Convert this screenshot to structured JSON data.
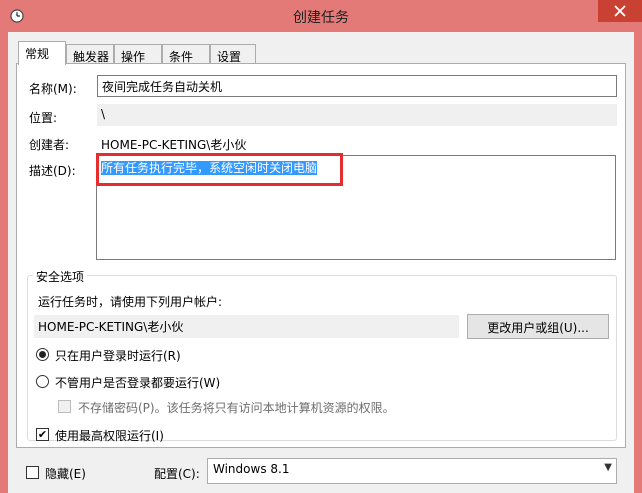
{
  "window": {
    "title": "创建任务"
  },
  "tabs": [
    {
      "label": "常规",
      "active": true
    },
    {
      "label": "触发器",
      "active": false
    },
    {
      "label": "操作",
      "active": false
    },
    {
      "label": "条件",
      "active": false
    },
    {
      "label": "设置",
      "active": false
    }
  ],
  "general": {
    "name_label": "名称(M):",
    "name_value": "夜间完成任务自动关机",
    "location_label": "位置:",
    "location_value": "\\",
    "author_label": "创建者:",
    "author_value": "HOME-PC-KETING\\老小伙",
    "description_label": "描述(D):",
    "description_value": "所有任务执行完毕，系统空闲时关闭电脑"
  },
  "security": {
    "group_title": "安全选项",
    "run_as_prompt": "运行任务时，请使用下列用户帐户:",
    "account_value": "HOME-PC-KETING\\老小伙",
    "change_user_button": "更改用户或组(U)...",
    "radio_logged_on": "只在用户登录时运行(R)",
    "radio_logged_on_checked": true,
    "radio_whether_logged": "不管用户是否登录都要运行(W)",
    "radio_whether_logged_checked": false,
    "no_store_password": "不存储密码(P)。该任务将只有访问本地计算机资源的权限。",
    "highest_privileges": "使用最高权限运行(I)",
    "highest_privileges_checked": true,
    "check_mark": "✔"
  },
  "footer": {
    "hidden_label": "隐藏(E)",
    "hidden_checked": false,
    "configure_label": "配置(C):",
    "configure_value": "Windows 8.1",
    "dropdown_arrow": "▼"
  },
  "colors": {
    "title_bar": "#e37a78",
    "close_button": "#c84133",
    "selection": "#3399ff",
    "annotation_red": "#e52d2d"
  },
  "icons": {
    "title": "clock-icon",
    "close": "close-icon"
  }
}
